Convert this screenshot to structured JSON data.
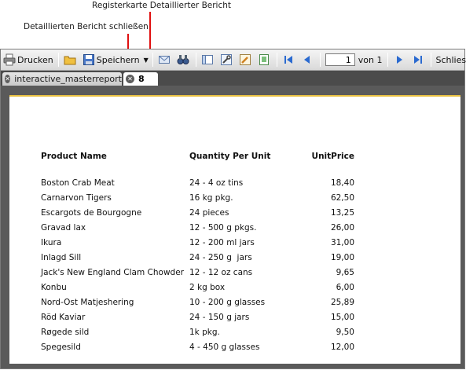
{
  "callouts": {
    "tab_label": "Registerkarte Detaillierter Bericht",
    "close_label": "Detaillierten Bericht schließen"
  },
  "toolbar": {
    "print_label": "Drucken",
    "save_label": "Speichern",
    "page_value": "1",
    "page_of_label": "von 1",
    "close_label": "Schliessen"
  },
  "tabs": [
    {
      "label": "interactive_masterreport"
    },
    {
      "label": "8"
    }
  ],
  "report": {
    "headers": [
      "Product Name",
      "Quantity Per Unit",
      "UnitPrice"
    ],
    "rows": [
      [
        "Boston Crab Meat",
        "24 - 4 oz tins",
        "18,40"
      ],
      [
        "Carnarvon Tigers",
        "16 kg pkg.",
        "62,50"
      ],
      [
        "Escargots de Bourgogne",
        "24 pieces",
        "13,25"
      ],
      [
        "Gravad lax",
        "12 - 500 g pkgs.",
        "26,00"
      ],
      [
        "Ikura",
        "12 - 200 ml jars",
        "31,00"
      ],
      [
        "Inlagd Sill",
        "24 - 250 g  jars",
        "19,00"
      ],
      [
        "Jack's New England Clam Chowder",
        "12 - 12 oz cans",
        "9,65"
      ],
      [
        "Konbu",
        "2 kg box",
        "6,00"
      ],
      [
        "Nord-Ost Matjeshering",
        "10 - 200 g glasses",
        "25,89"
      ],
      [
        "Röd Kaviar",
        "24 - 150 g jars",
        "15,00"
      ],
      [
        "Røgede sild",
        "1k pkg.",
        "9,50"
      ],
      [
        "Spegesild",
        "4 - 450 g glasses",
        "12,00"
      ]
    ]
  },
  "colors": {
    "callout": "#e01010",
    "tabstrip": "#4b4b4b",
    "page_accent": "#e8c040"
  }
}
